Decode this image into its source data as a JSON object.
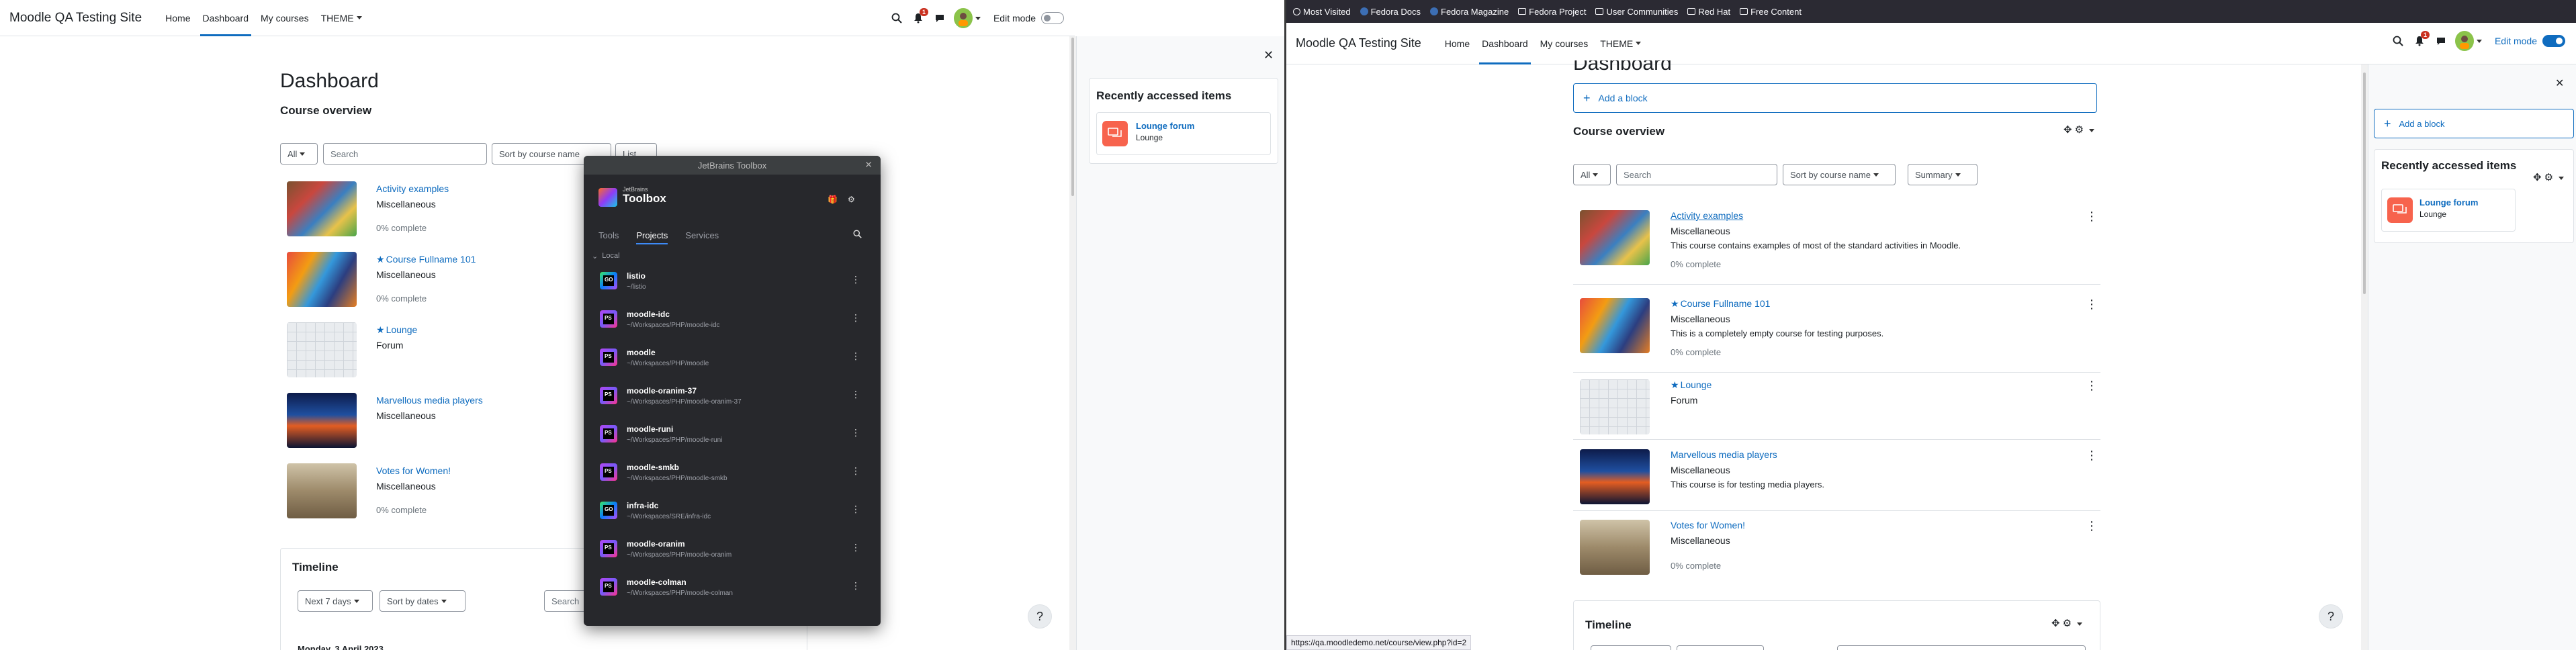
{
  "site": {
    "name": "Moodle QA Testing Site",
    "nav": [
      "Home",
      "Dashboard",
      "My courses",
      "THEME"
    ],
    "edit_mode_label": "Edit mode",
    "notification_count": "1"
  },
  "dashboard": {
    "title": "Dashboard",
    "course_overview_title": "Course overview",
    "filters": {
      "all": "All",
      "search_placeholder": "Search",
      "sort": "Sort by course name",
      "view_left": "List",
      "view_right": "Summary"
    },
    "courses": [
      {
        "name": "Activity examples",
        "starred": false,
        "category": "Miscellaneous",
        "summary": "This course contains examples of most of the standard activities in Moodle.",
        "progress": "0% complete"
      },
      {
        "name": "Course Fullname 101",
        "starred": true,
        "category": "Miscellaneous",
        "summary": "This is a completely empty course for testing purposes.",
        "progress": "0% complete"
      },
      {
        "name": "Lounge",
        "starred": true,
        "category": "Forum",
        "summary": "",
        "progress": ""
      },
      {
        "name": "Marvellous media players",
        "starred": false,
        "category": "Miscellaneous",
        "summary": "This course is for testing media players.",
        "progress": ""
      },
      {
        "name": "Votes for Women!",
        "starred": false,
        "category": "Miscellaneous",
        "summary": "",
        "progress": "0% complete"
      }
    ],
    "timeline": {
      "title": "Timeline",
      "range": "Next 7 days",
      "sort": "Sort by dates",
      "search_placeholder": "Search",
      "date_heading": "Monday, 3 April 2023"
    },
    "add_block": "Add a block"
  },
  "recently_accessed": {
    "title": "Recently accessed items",
    "item_name": "Lounge forum",
    "item_context": "Lounge"
  },
  "toolbox": {
    "window_title": "JetBrains Toolbox",
    "logo_small": "JetBrains",
    "logo_big": "Toolbox",
    "tabs": [
      "Tools",
      "Projects",
      "Services"
    ],
    "section": "Local",
    "projects": [
      {
        "name": "listio",
        "path": "~/listio",
        "ide": "go"
      },
      {
        "name": "moodle-idc",
        "path": "~/Workspaces/PHP/moodle-idc",
        "ide": "ps"
      },
      {
        "name": "moodle",
        "path": "~/Workspaces/PHP/moodle",
        "ide": "ps"
      },
      {
        "name": "moodle-oranim-37",
        "path": "~/Workspaces/PHP/moodle-oranim-37",
        "ide": "ps"
      },
      {
        "name": "moodle-runi",
        "path": "~/Workspaces/PHP/moodle-runi",
        "ide": "ps"
      },
      {
        "name": "moodle-smkb",
        "path": "~/Workspaces/PHP/moodle-smkb",
        "ide": "ps"
      },
      {
        "name": "infra-idc",
        "path": "~/Workspaces/SRE/infra-idc",
        "ide": "go"
      },
      {
        "name": "moodle-oranim",
        "path": "~/Workspaces/PHP/moodle-oranim",
        "ide": "ps"
      },
      {
        "name": "moodle-colman",
        "path": "~/Workspaces/PHP/moodle-colman",
        "ide": "ps"
      }
    ]
  },
  "browser": {
    "bookmarks": [
      "Most Visited",
      "Fedora Docs",
      "Fedora Magazine",
      "Fedora Project",
      "User Communities",
      "Red Hat",
      "Free Content"
    ],
    "status_url": "https://qa.moodledemo.net/course/view.php?id=2"
  },
  "help_glyph": "?",
  "colors": {
    "brand": "#0f6cbf",
    "forum": "#f7634d",
    "toolbox_bg": "#27282c",
    "bookmarks_bg": "#2b2a33"
  }
}
